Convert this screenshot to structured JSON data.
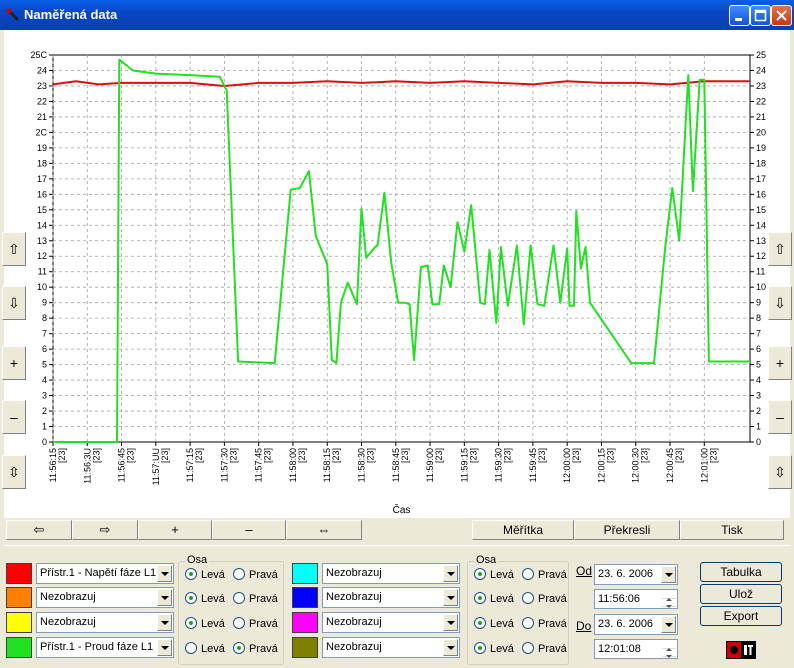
{
  "window": {
    "title": "Naměřená data"
  },
  "colors": {
    "voltage": "#D81010",
    "current": "#22E022",
    "grid": "#A0A0A0"
  },
  "chart_data": {
    "type": "line",
    "title": "",
    "xlabel": "Čas",
    "ylabel": "",
    "ylim": [
      0,
      25
    ],
    "xlim": [
      "11:56:15",
      "12:01:20"
    ],
    "y_ticks": [
      "0",
      "1",
      "2",
      "3",
      "4",
      "5",
      "6",
      "7",
      "8",
      "9",
      "10",
      "11",
      "12",
      "13",
      "14",
      "15",
      "16",
      "17",
      "18",
      "19",
      "20",
      "21",
      "22",
      "23",
      "24",
      "25"
    ],
    "y_ticks_shown": [
      "0",
      "1",
      "2",
      "3",
      "4",
      "5",
      "6",
      "7",
      "8",
      "9",
      "10",
      "11",
      "12",
      "13",
      "14",
      "15",
      "16",
      "17",
      "18",
      "19",
      "2C",
      "21",
      "22",
      "23",
      "24",
      "25C"
    ],
    "y_ticks_right": [
      "0",
      "1",
      "2",
      "3",
      "4",
      "5",
      "6",
      "7",
      "8",
      "9",
      "10",
      "11",
      "12",
      "13",
      "14",
      "15",
      "16",
      "17",
      "18",
      "19",
      "20",
      "21",
      "22",
      "23",
      "24",
      "25"
    ],
    "x_ticks": [
      {
        "time": "11:56:15",
        "day": "[23]"
      },
      {
        "time": "11:56:30",
        "day": "[23]"
      },
      {
        "time": "11:56:45",
        "day": "[23]"
      },
      {
        "time": "11:57:00",
        "day": "[23]"
      },
      {
        "time": "11:57:15",
        "day": "[23]"
      },
      {
        "time": "11:57:30",
        "day": "[23]"
      },
      {
        "time": "11:57:45",
        "day": "[23]"
      },
      {
        "time": "11:58:00",
        "day": "[23]"
      },
      {
        "time": "11:58:15",
        "day": "[23]"
      },
      {
        "time": "11:58:30",
        "day": "[23]"
      },
      {
        "time": "11:58:45",
        "day": "[23]"
      },
      {
        "time": "11:59:00",
        "day": "[23]"
      },
      {
        "time": "11:59:15",
        "day": "[23]"
      },
      {
        "time": "11:59:30",
        "day": "[23]"
      },
      {
        "time": "11:59:45",
        "day": "[23]"
      },
      {
        "time": "12:00:00",
        "day": "[23]"
      },
      {
        "time": "12:00:15",
        "day": "[23]"
      },
      {
        "time": "12:00:30",
        "day": "[23]"
      },
      {
        "time": "12:00:45",
        "day": "[23]"
      },
      {
        "time": "12:01:00",
        "day": "[23]"
      }
    ],
    "x_ticks_shown": [
      {
        "time": "11:56:15",
        "day": "[23]"
      },
      {
        "time": "11:56:3U",
        "day": "[23]"
      },
      {
        "time": "11:56:45",
        "day": "[23]"
      },
      {
        "time": "11:57:UU",
        "day": "[23]"
      },
      {
        "time": "11:57:15",
        "day": "[23]"
      },
      {
        "time": "11:57:30",
        "day": "[23]"
      },
      {
        "time": "11:57:45",
        "day": "[23]"
      },
      {
        "time": "11:58:00",
        "day": "[23]"
      },
      {
        "time": "11:58:15",
        "day": "[23]"
      },
      {
        "time": "11:58:30",
        "day": "[23]"
      },
      {
        "time": "11:58:45",
        "day": "[23]"
      },
      {
        "time": "11:59:00",
        "day": "[23]"
      },
      {
        "time": "11:59:15",
        "day": "[23]"
      },
      {
        "time": "11:59:30",
        "day": "[23]"
      },
      {
        "time": "11:59:45",
        "day": "[23]"
      },
      {
        "time": "12:00:00",
        "day": "[23]"
      },
      {
        "time": "12:00:15",
        "day": "[23]"
      },
      {
        "time": "12:00:30",
        "day": "[23]"
      },
      {
        "time": "12:00:45",
        "day": "[23]"
      },
      {
        "time": "12:01:00",
        "day": "[23]"
      }
    ],
    "grid": true,
    "series": [
      {
        "name": "Přístr.1 - Napětí fáze L1",
        "color": "#D81010",
        "x": [
          "11:56:15",
          "11:56:25",
          "11:56:35",
          "11:56:45",
          "11:57:00",
          "11:57:15",
          "11:57:30",
          "11:57:45",
          "11:58:00",
          "11:58:15",
          "11:58:30",
          "11:58:45",
          "11:59:00",
          "11:59:15",
          "11:59:30",
          "11:59:45",
          "12:00:00",
          "12:00:15",
          "12:00:30",
          "12:00:45",
          "12:01:00",
          "12:01:20"
        ],
        "y": [
          23.1,
          23.3,
          23.1,
          23.2,
          23.2,
          23.2,
          23.0,
          23.2,
          23.2,
          23.3,
          23.2,
          23.3,
          23.2,
          23.3,
          23.2,
          23.1,
          23.3,
          23.2,
          23.2,
          23.1,
          23.3,
          23.3
        ]
      },
      {
        "name": "Přístr.1 - Proud fáze L1",
        "color": "#22E022",
        "x": [
          "11:56:15",
          "11:56:43",
          "11:56:44",
          "11:56:50",
          "11:57:00",
          "11:57:15",
          "11:57:28",
          "11:57:31",
          "11:57:36",
          "11:57:52",
          "11:57:59",
          "11:58:03",
          "11:58:07",
          "11:58:10",
          "11:58:15",
          "11:58:17",
          "11:58:19",
          "11:58:21",
          "11:58:24",
          "11:58:28",
          "11:58:30",
          "11:58:32",
          "11:58:36",
          "11:58:37",
          "11:58:40",
          "11:58:43",
          "11:58:46",
          "11:58:49",
          "11:58:51",
          "11:58:53",
          "11:58:56",
          "11:58:59",
          "11:59:01",
          "11:59:04",
          "11:59:06",
          "11:59:09",
          "11:59:12",
          "11:59:15",
          "11:59:18",
          "11:59:22",
          "11:59:24",
          "11:59:26",
          "11:59:29",
          "11:59:31",
          "11:59:34",
          "11:59:38",
          "11:59:41",
          "11:59:44",
          "11:59:47",
          "11:59:50",
          "11:59:54",
          "11:59:57",
          "12:00:00",
          "12:00:01",
          "12:00:03",
          "12:00:04",
          "12:00:06",
          "12:00:08",
          "12:00:10",
          "12:00:28",
          "12:00:32",
          "12:00:38",
          "12:00:43",
          "12:00:46",
          "12:00:49",
          "12:00:53",
          "12:00:55",
          "12:00:58",
          "12:01:00",
          "12:01:02",
          "12:01:20"
        ],
        "y": [
          0,
          0,
          24.7,
          24.0,
          23.8,
          23.7,
          23.6,
          22.7,
          5.2,
          5.1,
          16.3,
          16.4,
          17.5,
          13.3,
          11.5,
          5.3,
          5.1,
          9.0,
          10.3,
          8.9,
          15.1,
          11.9,
          12.6,
          12.7,
          16.1,
          11.6,
          9.0,
          9.0,
          8.9,
          5.3,
          11.3,
          11.4,
          8.9,
          8.9,
          11.4,
          10.0,
          14.2,
          12.3,
          15.3,
          9.0,
          8.9,
          12.4,
          7.7,
          12.6,
          8.8,
          12.7,
          7.6,
          12.7,
          8.9,
          8.8,
          12.7,
          9.0,
          12.5,
          8.8,
          8.8,
          14.9,
          11.2,
          12.6,
          9.0,
          5.1,
          5.1,
          5.1,
          12.7,
          16.4,
          13.0,
          23.7,
          16.2,
          23.4,
          23.4,
          5.2,
          5.2
        ]
      }
    ]
  },
  "left_buttons": [
    "⇧",
    "⇩",
    "+",
    "–",
    "⇳"
  ],
  "right_buttons": [
    "⇧",
    "⇩",
    "+",
    "–",
    "⇳"
  ],
  "nav": {
    "left": "⇦",
    "right": "⇨",
    "plus": "+",
    "minus": "–",
    "both": "⇔",
    "meritka": "Měřítka",
    "prekresli": "Překresli",
    "tisk": "Tisk"
  },
  "channels_left": [
    {
      "color": "#FF0000",
      "label": "Přístr.1 - Napětí fáze L1",
      "left": "Levá",
      "right": "Pravá",
      "selected": "left"
    },
    {
      "color": "#FF8000",
      "label": "Nezobrazuj",
      "left": "Levá",
      "right": "Pravá",
      "selected": "left"
    },
    {
      "color": "#FFFF00",
      "label": "Nezobrazuj",
      "left": "Levá",
      "right": "Pravá",
      "selected": "left"
    },
    {
      "color": "#22E022",
      "label": "Přístr.1 - Proud fáze L1",
      "left": "Levá",
      "right": "Pravá",
      "selected": "right"
    }
  ],
  "channels_right": [
    {
      "color": "#00FFFF",
      "label": "Nezobrazuj",
      "left": "Levá",
      "right": "Pravá",
      "selected": "left"
    },
    {
      "color": "#0000FF",
      "label": "Nezobrazuj",
      "left": "Levá",
      "right": "Pravá",
      "selected": "left"
    },
    {
      "color": "#FF00FF",
      "label": "Nezobrazuj",
      "left": "Levá",
      "right": "Pravá",
      "selected": "left"
    },
    {
      "color": "#808000",
      "label": "Nezobrazuj",
      "left": "Levá",
      "right": "Pravá",
      "selected": "left"
    }
  ],
  "osa_label": "Osa",
  "range": {
    "od_label": "Od",
    "do_label": "Do",
    "od_date": "23. 6. 2006",
    "od_time": "11:56:06",
    "do_date": "23. 6. 2006",
    "do_time": "12:01:08"
  },
  "buttons": {
    "tabulka": "Tabulka",
    "uloz": "Ulož",
    "export": "Export"
  }
}
